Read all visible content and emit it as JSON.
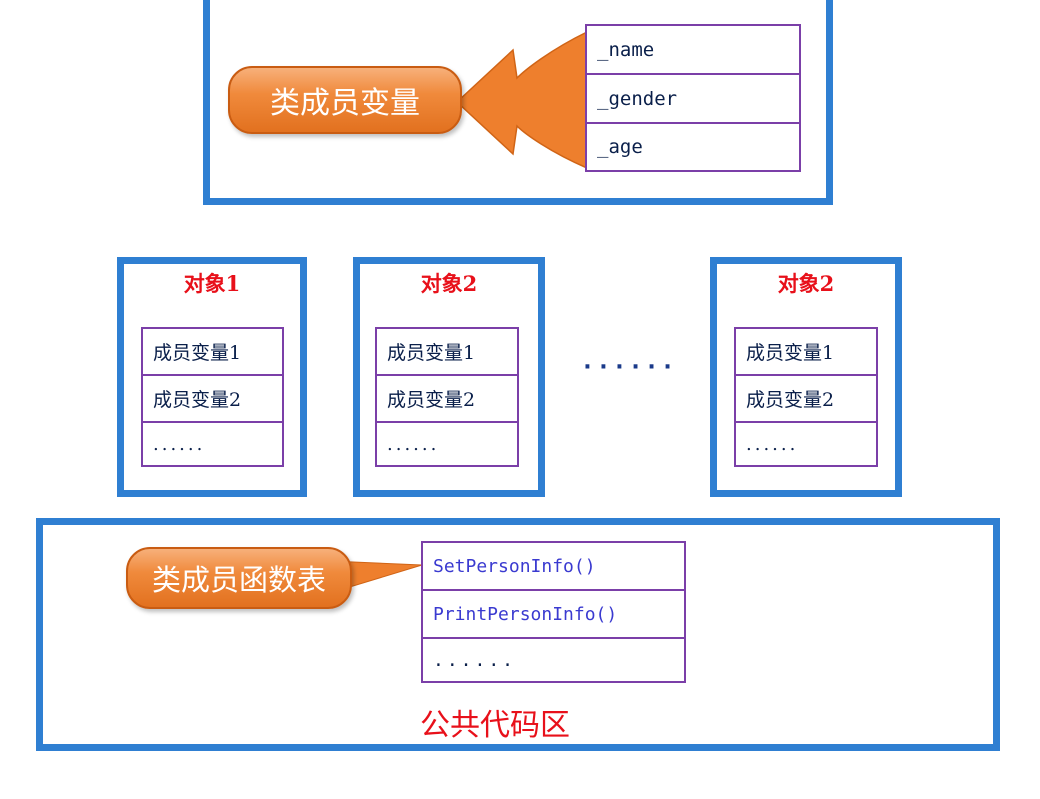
{
  "class_box": {
    "callout_label": "类成员变量",
    "members": [
      "_name",
      "_gender",
      "_age"
    ]
  },
  "objects": [
    {
      "title": "对象1",
      "rows": [
        "成员变量1",
        "成员变量2",
        "......"
      ]
    },
    {
      "title": "对象2",
      "rows": [
        "成员变量1",
        "成员变量2",
        "......"
      ]
    },
    {
      "title": "对象2",
      "rows": [
        "成员变量1",
        "成员变量2",
        "......"
      ]
    }
  ],
  "ellipsis_between_objects": "· · · · · ·",
  "common_code": {
    "callout_label": "类成员函数表",
    "functions": [
      "SetPersonInfo()",
      "PrintPersonInfo()",
      "......"
    ],
    "region_label": "公共代码区"
  },
  "colors": {
    "box_border": "#2f7fd2",
    "table_border": "#7b3fa8",
    "callout_fill": "#f08a3c",
    "title_red": "#e8101a",
    "function_blue": "#3a3ad0"
  }
}
